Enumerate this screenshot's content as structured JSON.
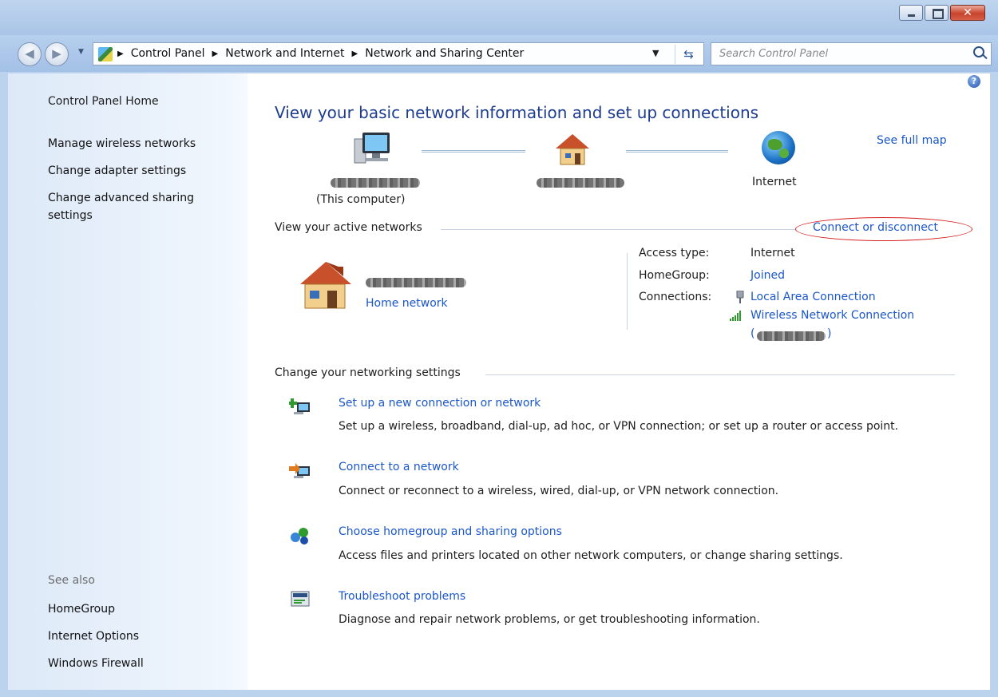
{
  "window": {
    "buttons": {
      "minimize": "–",
      "maximize": "□",
      "close": "✕"
    }
  },
  "address": {
    "crumbs": [
      "Control Panel",
      "Network and Internet",
      "Network and Sharing Center"
    ],
    "search_placeholder": "Search Control Panel"
  },
  "sidebar": {
    "home": "Control Panel Home",
    "items": [
      {
        "label": "Manage wireless networks"
      },
      {
        "label": "Change adapter settings"
      },
      {
        "label": "Change advanced sharing"
      },
      {
        "label": "settings"
      }
    ],
    "see_also": {
      "heading": "See also",
      "items": [
        {
          "label": "HomeGroup"
        },
        {
          "label": "Internet Options"
        },
        {
          "label": "Windows Firewall"
        }
      ]
    }
  },
  "main": {
    "title": "View your basic network information and set up connections",
    "see_full_map": "See full map",
    "map": {
      "computer_label": "(This computer)",
      "internet_label": "Internet"
    },
    "active": {
      "heading": "View your active networks",
      "connect_link": "Connect or disconnect",
      "network_type": "Home network",
      "access_type_label": "Access type:",
      "access_type_value": "Internet",
      "homegroup_label": "HomeGroup:",
      "homegroup_value": "Joined",
      "connections_label": "Connections:",
      "connection_1": "Local Area Connection",
      "connection_2": "Wireless Network Connection",
      "connection_2_paren_open": "(",
      "connection_2_paren_close": ")"
    },
    "settings": {
      "heading": "Change your networking settings",
      "actions": [
        {
          "title": "Set up a new connection or network",
          "desc": "Set up a wireless, broadband, dial-up, ad hoc, or VPN connection; or set up a router or access point."
        },
        {
          "title": "Connect to a network",
          "desc": "Connect or reconnect to a wireless, wired, dial-up, or VPN network connection."
        },
        {
          "title": "Choose homegroup and sharing options",
          "desc": "Access files and printers located on other network computers, or change sharing settings."
        },
        {
          "title": "Troubleshoot problems",
          "desc": "Diagnose and repair network problems, or get troubleshooting information."
        }
      ]
    },
    "help": "?"
  },
  "colors": {
    "link": "#1b57c9",
    "title": "#1e3d8f",
    "annotation": "#d82020"
  }
}
